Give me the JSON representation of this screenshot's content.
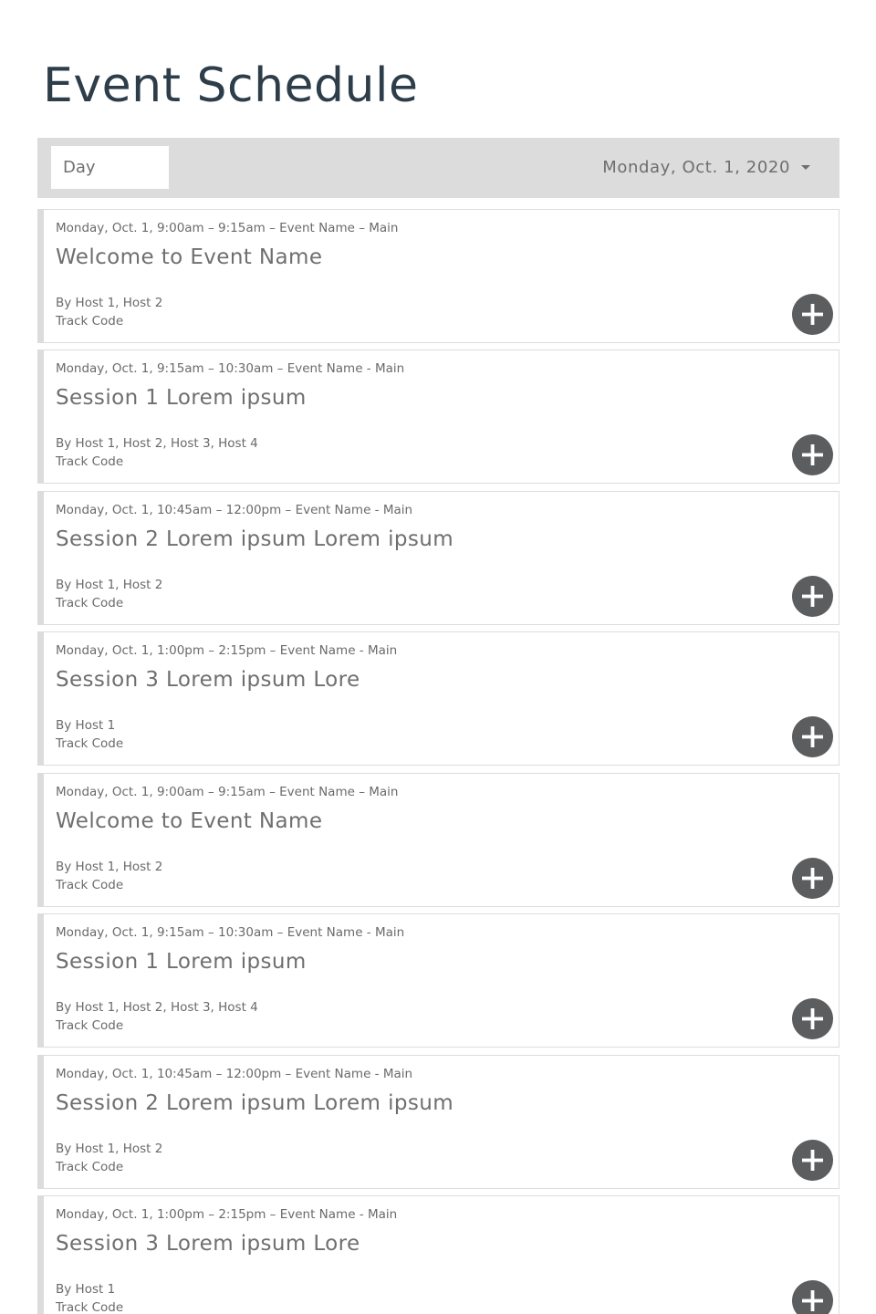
{
  "page": {
    "title": "Event Schedule"
  },
  "filters": {
    "view_label": "Day",
    "date_label": "Monday, Oct. 1, 2020",
    "date_icon": "caret-down-icon"
  },
  "colors": {
    "title": "#2d3e4a",
    "bar": "#dcdcdc",
    "button": "#5c5d5f",
    "text": "#6f6f6f"
  },
  "sessions": [
    {
      "meta": "Monday, Oct. 1, 9:00am – 9:15am – Event Name – Main",
      "title": "Welcome to Event Name",
      "hosts": "By Host 1, Host 2",
      "track": "Track Code",
      "action_icon": "plus-icon"
    },
    {
      "meta": "Monday, Oct. 1, 9:15am – 10:30am – Event Name - Main",
      "title": "Session 1 Lorem ipsum",
      "hosts": "By Host 1, Host 2, Host 3, Host 4",
      "track": "Track Code",
      "action_icon": "plus-icon"
    },
    {
      "meta": "Monday, Oct. 1, 10:45am – 12:00pm – Event Name - Main",
      "title": "Session 2 Lorem ipsum Lorem ipsum",
      "hosts": "By Host 1, Host 2",
      "track": "Track Code",
      "action_icon": "plus-icon"
    },
    {
      "meta": "Monday, Oct. 1, 1:00pm – 2:15pm – Event Name - Main",
      "title": "Session 3 Lorem ipsum Lore",
      "hosts": "By Host 1",
      "track": "Track Code",
      "action_icon": "plus-icon"
    },
    {
      "meta": "Monday, Oct. 1, 9:00am – 9:15am – Event Name – Main",
      "title": "Welcome to Event Name",
      "hosts": "By Host 1, Host 2",
      "track": "Track Code",
      "action_icon": "plus-icon"
    },
    {
      "meta": "Monday, Oct. 1, 9:15am – 10:30am – Event Name - Main",
      "title": "Session 1 Lorem ipsum",
      "hosts": "By Host 1, Host 2, Host 3, Host 4",
      "track": "Track Code",
      "action_icon": "plus-icon"
    },
    {
      "meta": "Monday, Oct. 1, 10:45am – 12:00pm – Event Name - Main",
      "title": "Session 2 Lorem ipsum Lorem ipsum",
      "hosts": "By Host 1, Host 2",
      "track": "Track Code",
      "action_icon": "plus-icon"
    },
    {
      "meta": "Monday, Oct. 1, 1:00pm – 2:15pm – Event Name - Main",
      "title": "Session 3 Lorem ipsum Lore",
      "hosts": "By Host 1",
      "track": "Track Code",
      "action_icon": "plus-icon"
    }
  ]
}
